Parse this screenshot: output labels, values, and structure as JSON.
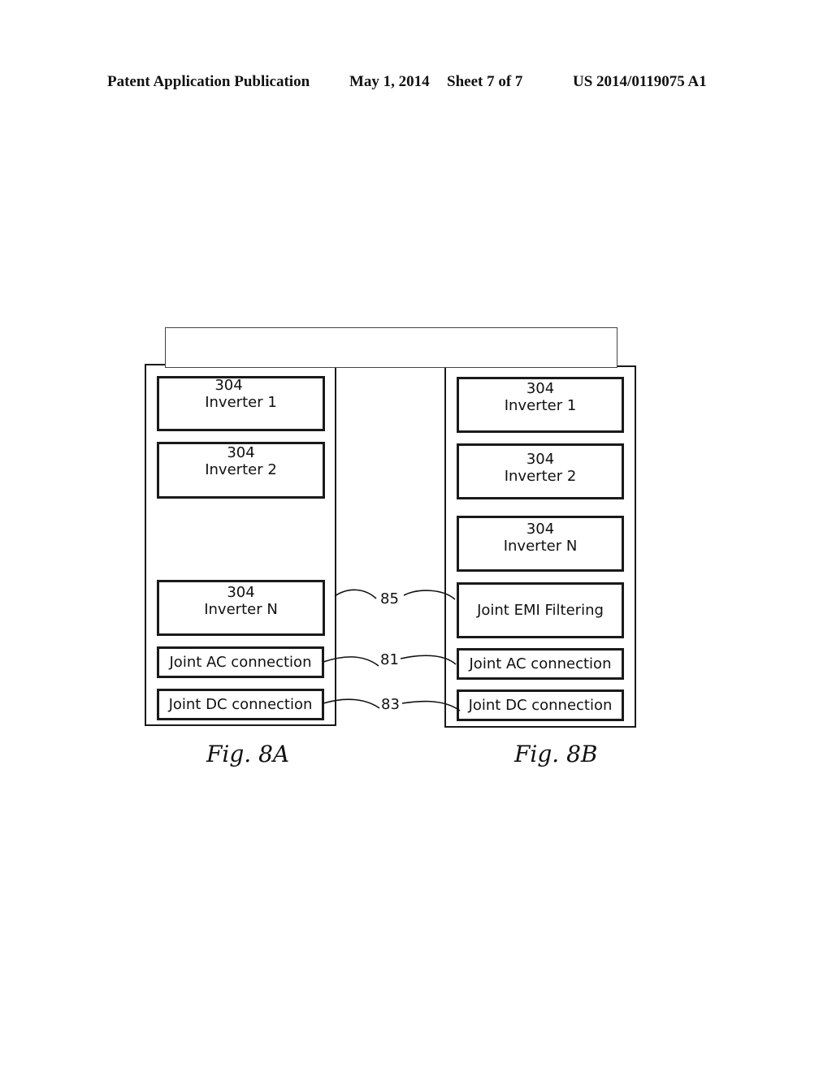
{
  "header": {
    "publication": "Patent Application Publication",
    "date": "May 1, 2014",
    "sheet": "Sheet 7 of 7",
    "number": "US 2014/0119075 A1"
  },
  "figures": {
    "fig8a": {
      "caption": "Fig. 8A",
      "blocks": [
        {
          "num": "304",
          "label": "Inverter 1"
        },
        {
          "num": "304",
          "label": "Inverter 2"
        },
        {
          "num": "304",
          "label": "Inverter N"
        },
        {
          "label": "Joint AC connection"
        },
        {
          "label": "Joint DC connection"
        }
      ]
    },
    "fig8b": {
      "caption": "Fig. 8B",
      "blocks": [
        {
          "num": "304",
          "label": "Inverter 1"
        },
        {
          "num": "304",
          "label": "Inverter 2"
        },
        {
          "num": "304",
          "label": "Inverter N"
        },
        {
          "label": "Joint EMI Filtering"
        },
        {
          "label": "Joint AC connection"
        },
        {
          "label": "Joint DC connection"
        }
      ]
    }
  },
  "references": {
    "emi": "85",
    "ac": "81",
    "dc": "83"
  }
}
